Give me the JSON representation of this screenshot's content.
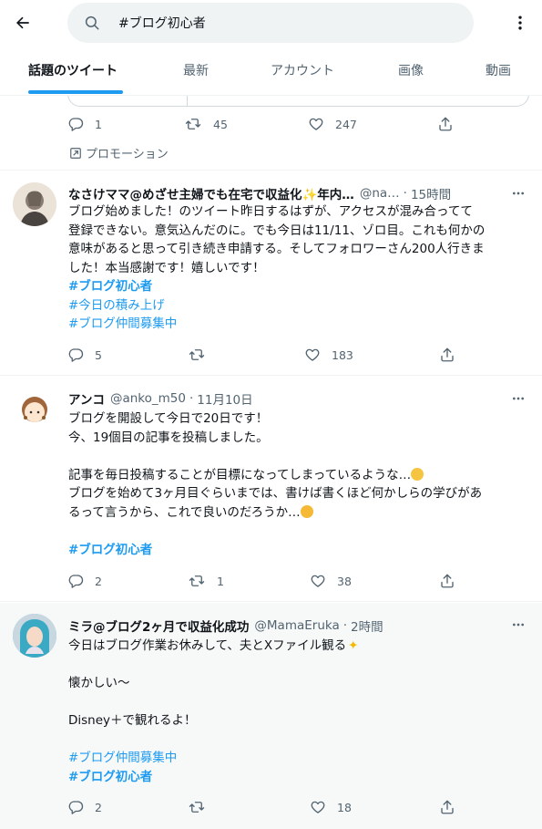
{
  "header": {
    "search_value": "#ブログ初心者",
    "tabs": [
      "話題のツイート",
      "最新",
      "アカウント",
      "画像",
      "動画"
    ]
  },
  "promoted": {
    "replies": "1",
    "retweets": "45",
    "likes": "247",
    "label": "プロモーション"
  },
  "tweets": [
    {
      "name": "なさけママ@めざせ主婦でも在宅で収益化✨年内…",
      "handle": "@na…",
      "time": "15時間",
      "lines": [
        "ブログ始めました！のツイート昨日するはずが、アクセスが混み合ってて",
        "登録できない。意気込んだのに。でも今日は11/11、ゾロ目。これも何かの",
        "意味があると思って引き続き申請する。そしてフォロワーさん200人行きま",
        "した！本当感謝です！嬉しいです！"
      ],
      "hashtags": [
        "#ブログ初心者",
        "#今日の積み上げ",
        "#ブログ仲間募集中"
      ],
      "replies": "5",
      "retweets": "",
      "likes": "183"
    },
    {
      "name": "アンコ",
      "handle": "@anko_m50",
      "time": "11月10日",
      "lines": [
        "ブログを開設して今日で20日です！",
        "今、19個目の記事を投稿しました。",
        "",
        "記事を毎日投稿することが目標になってしまっているような…",
        "ブログを始めて3ヶ月目ぐらいまでは、書けば書くほど何かしらの学びがあ",
        "るって言うから、これで良いのだろうか…"
      ],
      "hashtags": [
        "#ブログ初心者"
      ],
      "replies": "2",
      "retweets": "1",
      "likes": "38"
    },
    {
      "name": "ミラ@ブログ2ヶ月で収益化成功",
      "handle": "@MamaEruka",
      "time": "2時間",
      "lines": [
        "今日はブログ作業お休みして、夫とXファイル観る",
        "",
        "懐かしい〜",
        "",
        "Disney＋で観れるよ！"
      ],
      "hashtags": [
        "#ブログ仲間募集中",
        "#ブログ初心者"
      ],
      "replies": "2",
      "retweets": "",
      "likes": "18"
    }
  ]
}
